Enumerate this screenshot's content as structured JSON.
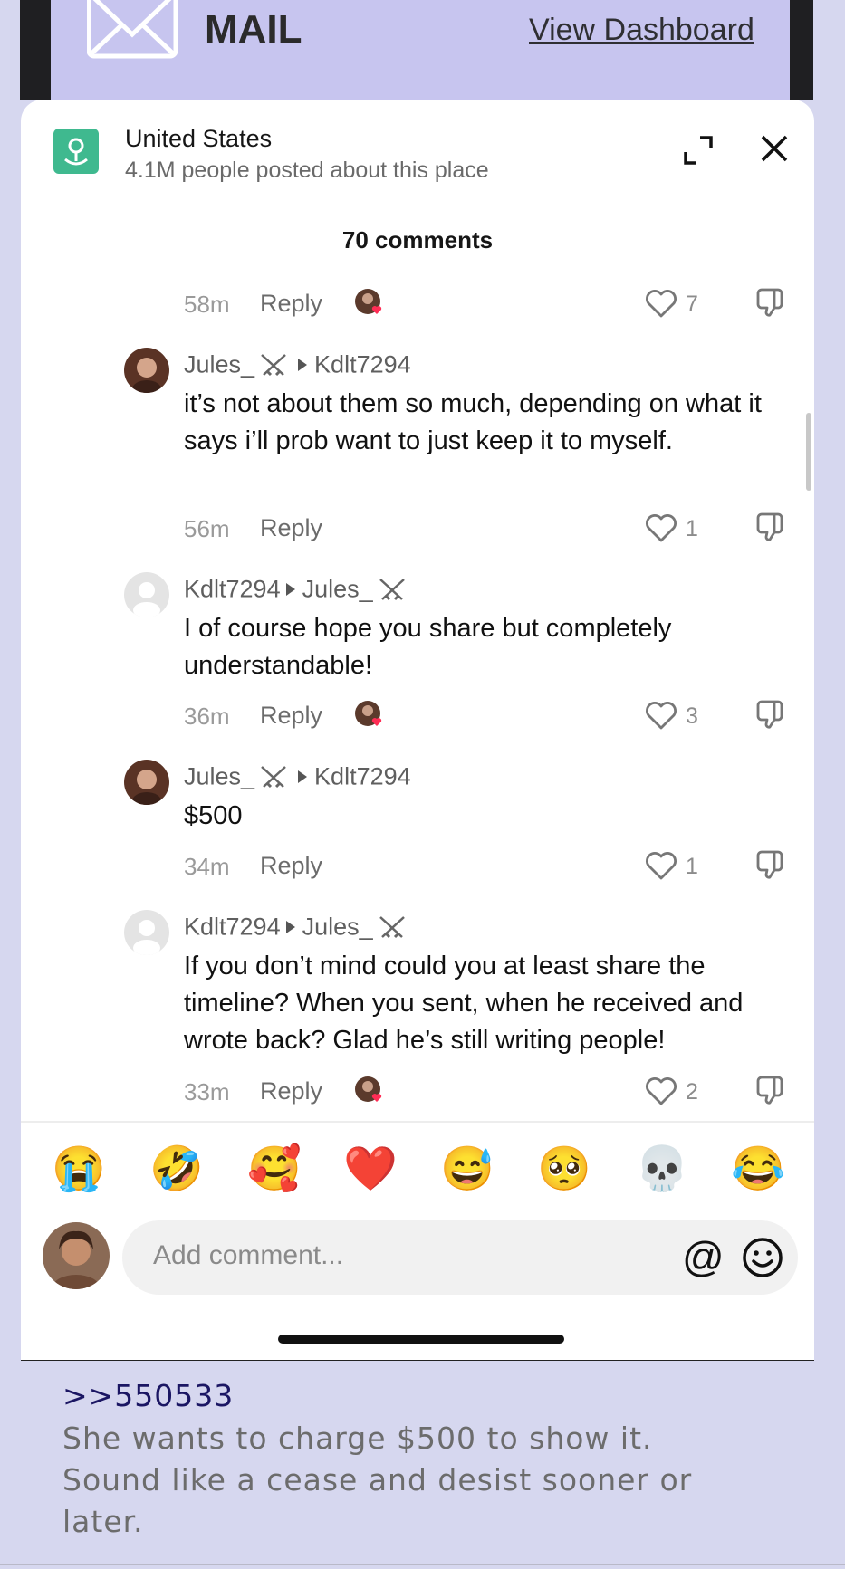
{
  "header": {
    "title": "MAIL",
    "dashboard_link": "View Dashboard"
  },
  "location": {
    "name": "United States",
    "subtitle": "4.1M people posted about this place"
  },
  "comments_header": "70 comments",
  "comments": [
    {
      "time": "58m",
      "reply": "Reply",
      "likes": "7",
      "creator_liked": true
    },
    {
      "author": "Jules_",
      "replying_to": "Kdlt7294",
      "text": "it’s not about them so much, depending on what it says i’ll prob want to just keep it to myself.",
      "time": "56m",
      "reply": "Reply",
      "likes": "1"
    },
    {
      "author": "Kdlt7294",
      "replying_to": "Jules_",
      "text": "I of course hope you share but completely understandable!",
      "time": "36m",
      "reply": "Reply",
      "likes": "3",
      "creator_liked": true
    },
    {
      "author": "Jules_",
      "replying_to": "Kdlt7294",
      "text": "$500",
      "time": "34m",
      "reply": "Reply",
      "likes": "1"
    },
    {
      "author": "Kdlt7294",
      "replying_to": "Jules_",
      "text": "If you don’t mind could you at least share the timeline? When you sent, when he received and wrote back? Glad he’s still writing people!",
      "time": "33m",
      "reply": "Reply",
      "likes": "2",
      "creator_liked": true
    }
  ],
  "emoji_bar": [
    "😭",
    "🤣",
    "🥰",
    "❤️",
    "😅",
    "🥺",
    "💀",
    "😂"
  ],
  "composer": {
    "placeholder": "Add comment...",
    "at_symbol": "@"
  },
  "post": {
    "reference": ">>550533",
    "text": "She wants to charge $500 to show it. Sound like a cease and desist sooner or later."
  },
  "colors": {
    "background": "#d6d7ef",
    "banner": "#c7c5ef",
    "location_icon": "#3fb98f",
    "post_reference": "#1b1663"
  },
  "icons": [
    "mail-icon",
    "location-pin-icon",
    "expand-icon",
    "close-icon",
    "heart-icon",
    "dislike-icon",
    "sword-badge-icon",
    "smiley-icon"
  ]
}
